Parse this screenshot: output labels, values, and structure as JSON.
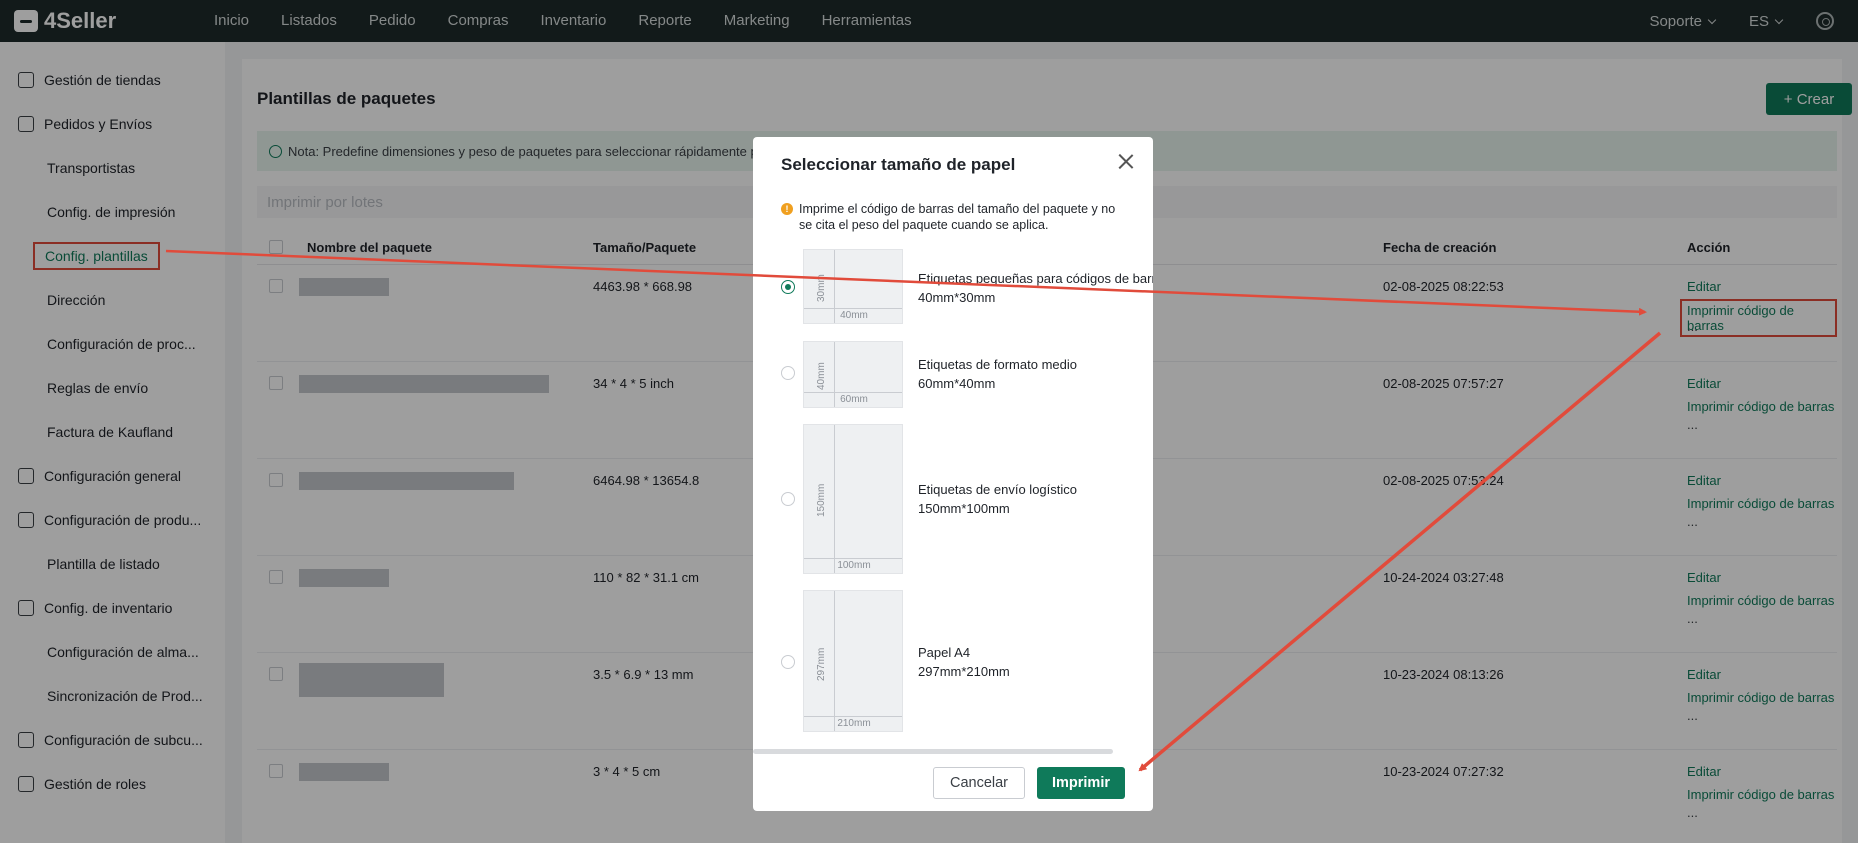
{
  "brand": "4Seller",
  "nav": [
    "Inicio",
    "Listados",
    "Pedido",
    "Compras",
    "Inventario",
    "Reporte",
    "Marketing",
    "Herramientas"
  ],
  "topbar_right": {
    "support": "Soporte",
    "lang": "ES"
  },
  "sidebar": {
    "items": [
      {
        "label": "Gestión de tiendas",
        "type": "group",
        "icon": "store-icon"
      },
      {
        "label": "Pedidos y Envíos",
        "type": "group",
        "icon": "clipboard-icon"
      },
      {
        "label": "Transportistas",
        "type": "sub"
      },
      {
        "label": "Config. de impresión",
        "type": "sub"
      },
      {
        "label": "Config. plantillas",
        "type": "sub",
        "active": true
      },
      {
        "label": "Dirección",
        "type": "sub"
      },
      {
        "label": "Configuración de proc...",
        "type": "sub"
      },
      {
        "label": "Reglas de envío",
        "type": "sub"
      },
      {
        "label": "Factura de Kaufland",
        "type": "sub"
      },
      {
        "label": "Configuración general",
        "type": "group",
        "icon": "printer-icon"
      },
      {
        "label": "Configuración de produ...",
        "type": "group",
        "icon": "product-box-icon"
      },
      {
        "label": "Plantilla de listado",
        "type": "sub"
      },
      {
        "label": "Config. de inventario",
        "type": "group",
        "icon": "inventory-icon"
      },
      {
        "label": "Configuración de alma...",
        "type": "sub"
      },
      {
        "label": "Sincronización de Prod...",
        "type": "sub"
      },
      {
        "label": "Configuración de subcu...",
        "type": "group",
        "icon": "subaccount-icon"
      },
      {
        "label": "Gestión de roles",
        "type": "group",
        "icon": "user-icon"
      }
    ]
  },
  "page": {
    "title": "Plantillas de paquetes",
    "create_button": "+ Crear",
    "note": "Nota: Predefine dimensiones y peso de paquetes para seleccionar rápidamente pla",
    "batch_print": "Imprimir por lotes",
    "columns": {
      "name": "Nombre del paquete",
      "size": "Tamaño/Paquete",
      "created": "Fecha de creación",
      "action": "Acción"
    },
    "rows": [
      {
        "size": "4463.98 * 668.98",
        "created": "02-08-2025 08:22:53"
      },
      {
        "size": "34 * 4 * 5 inch",
        "created": "02-08-2025 07:57:27"
      },
      {
        "size": "6464.98 * 13654.8",
        "created": "02-08-2025 07:53:24"
      },
      {
        "size": "110 * 82 * 31.1 cm",
        "created": "10-24-2024 03:27:48"
      },
      {
        "size": "3.5 * 6.9 * 13 mm",
        "created": "10-23-2024 08:13:26"
      },
      {
        "size": "3 * 4 * 5 cm",
        "created": "10-23-2024 07:27:32"
      }
    ],
    "actions": {
      "edit": "Editar",
      "print_barcode": "Imprimir código de barras",
      "more": "..."
    }
  },
  "modal": {
    "title": "Seleccionar tamaño de papel",
    "warning": "Imprime el código de barras del tamaño del paquete y no se cita el peso del paquete cuando se aplica.",
    "options": [
      {
        "name": "Etiquetas pequeñas para códigos de barr",
        "size": "40mm*30mm",
        "w": "40mm",
        "h": "30mm",
        "selected": true
      },
      {
        "name": "Etiquetas de formato medio",
        "size": "60mm*40mm",
        "w": "60mm",
        "h": "40mm",
        "selected": false
      },
      {
        "name": "Etiquetas de envío logístico",
        "size": "150mm*100mm",
        "w": "100mm",
        "h": "150mm",
        "selected": false
      },
      {
        "name": "Papel A4",
        "size": "297mm*210mm",
        "w": "210mm",
        "h": "297mm",
        "selected": false
      }
    ],
    "cancel": "Cancelar",
    "print": "Imprimir"
  },
  "colors": {
    "brand_green": "#0f7a5a",
    "highlight_red": "#e14b3b",
    "topbar": "#1e2a2a"
  }
}
